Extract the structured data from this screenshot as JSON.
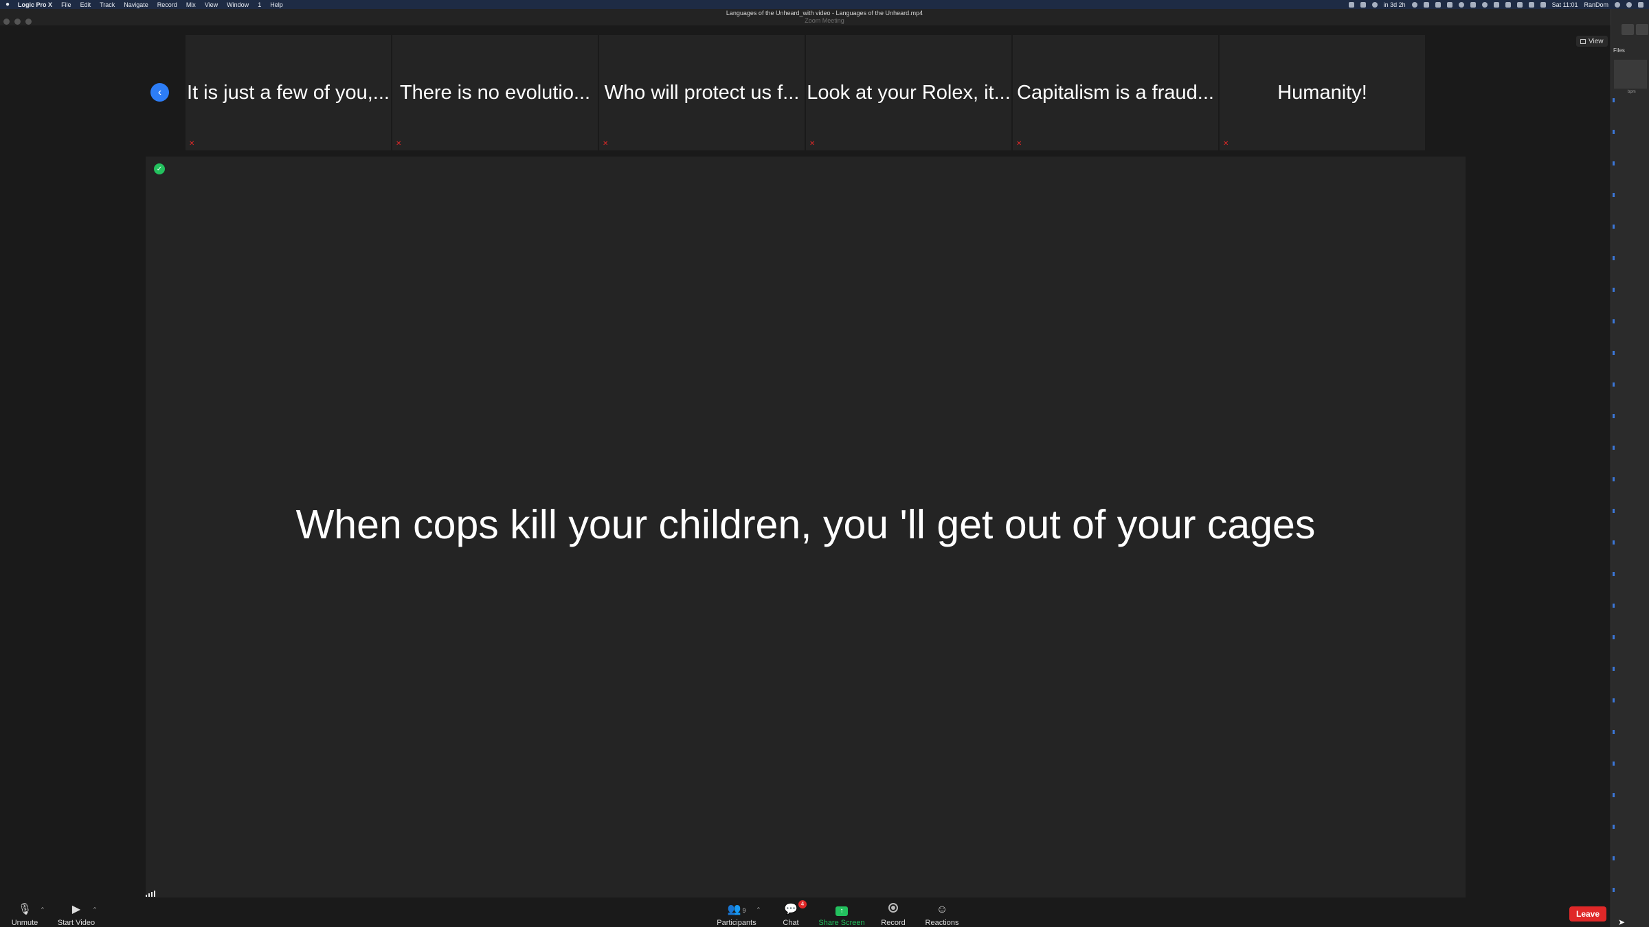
{
  "menubar": {
    "apple": "",
    "items": [
      "Logic Pro X",
      "File",
      "Edit",
      "Track",
      "Navigate",
      "Record",
      "Mix",
      "View",
      "Window",
      "1",
      "Help"
    ],
    "status_text_1": "in 3d 2h",
    "clock": "Sat 11:01",
    "user": "RanDom"
  },
  "window": {
    "doc_title": "Languages of the Unheard_with video - Languages of the Unheard.mp4",
    "title": "Zoom Meeting"
  },
  "view": {
    "label": "View"
  },
  "gallery": {
    "prev_glyph": "‹",
    "thumbnails": [
      "It is just a few of you,...",
      "There is no evolutio...",
      "Who will protect us f...",
      "Look at your Rolex, it...",
      "Capitalism is a fraud...",
      "Humanity!"
    ]
  },
  "speaker": {
    "caption": "When cops kill your children, you 'll get out of your cages"
  },
  "side_panel": {
    "files": "Files",
    "bpm": "bpm"
  },
  "toolbar": {
    "unmute": "Unmute",
    "start_video": "Start Video",
    "participants": "Participants",
    "participants_count": "9",
    "chat": "Chat",
    "chat_badge": "4",
    "share_screen": "Share Screen",
    "record": "Record",
    "reactions": "Reactions",
    "leave": "Leave"
  },
  "colors": {
    "accent_blue": "#2d7df6",
    "share_green": "#23c15e",
    "leave_red": "#e02828",
    "background": "#1a1a1a",
    "tile": "#242424"
  }
}
